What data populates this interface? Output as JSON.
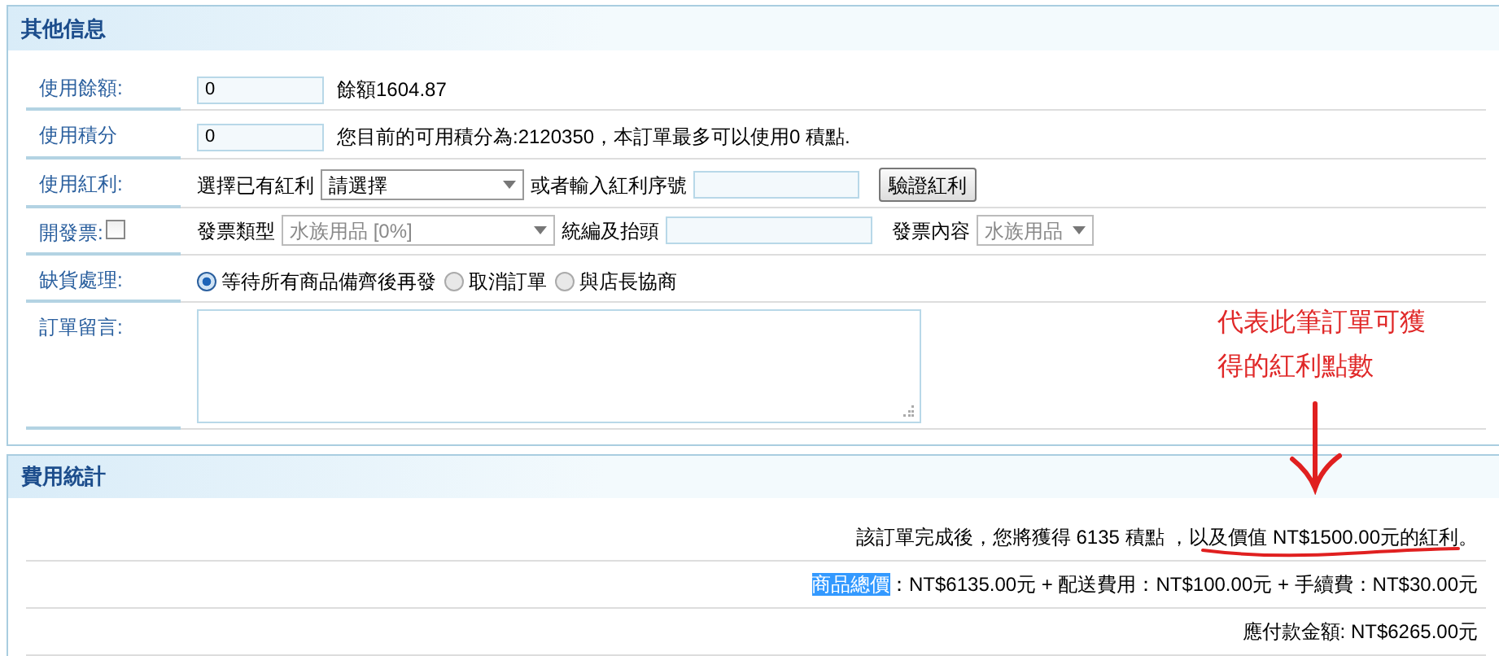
{
  "other_info": {
    "title": "其他信息",
    "rows": [
      {
        "kind": "input_note",
        "label": "使用餘額:",
        "value": "0",
        "note": "餘額1604.87"
      },
      {
        "kind": "input_note",
        "label": "使用積分",
        "value": "0",
        "note": "您目前的可用積分為:2120350，本訂單最多可以使用0 積點."
      },
      {
        "kind": "bonus",
        "label": "使用紅利:",
        "select_label": "選擇已有紅利",
        "select_value": "請選擇",
        "or_label": "或者輸入紅利序號",
        "button": "驗證紅利"
      },
      {
        "kind": "invoice",
        "label": "開發票:",
        "checked": false,
        "type_label": "發票類型",
        "type_value": "水族用品 [0%]",
        "disabled": true,
        "title_label": "統編及抬頭",
        "content_label": "發票內容",
        "content_value": "水族用品"
      },
      {
        "kind": "radio",
        "label": "缺貨處理:",
        "options": [
          {
            "label": "等待所有商品備齊後再發",
            "selected": true
          },
          {
            "label": "取消訂單",
            "selected": false
          },
          {
            "label": "與店長協商",
            "selected": false
          }
        ]
      },
      {
        "kind": "textarea",
        "label": "訂單留言:"
      }
    ]
  },
  "cost_summary": {
    "title": "費用統計",
    "lines": [
      {
        "parts": [
          {
            "text": "該訂單完成後，您將獲得 6135 積點 ，以及價值 NT$1500.00元的紅利。",
            "highlighted": false
          }
        ]
      },
      {
        "parts": [
          {
            "text": "商品總價",
            "highlighted": true
          },
          {
            "text": "：NT$6135.00元 + 配送費用：NT$100.00元 + 手續費：NT$30.00元",
            "highlighted": false
          }
        ]
      },
      {
        "parts": [
          {
            "text": "應付款金額: NT$6265.00元",
            "highlighted": false
          }
        ]
      }
    ]
  },
  "annotation": {
    "lines": [
      "代表此筆訂單可獲",
      "得的紅利點數"
    ]
  }
}
